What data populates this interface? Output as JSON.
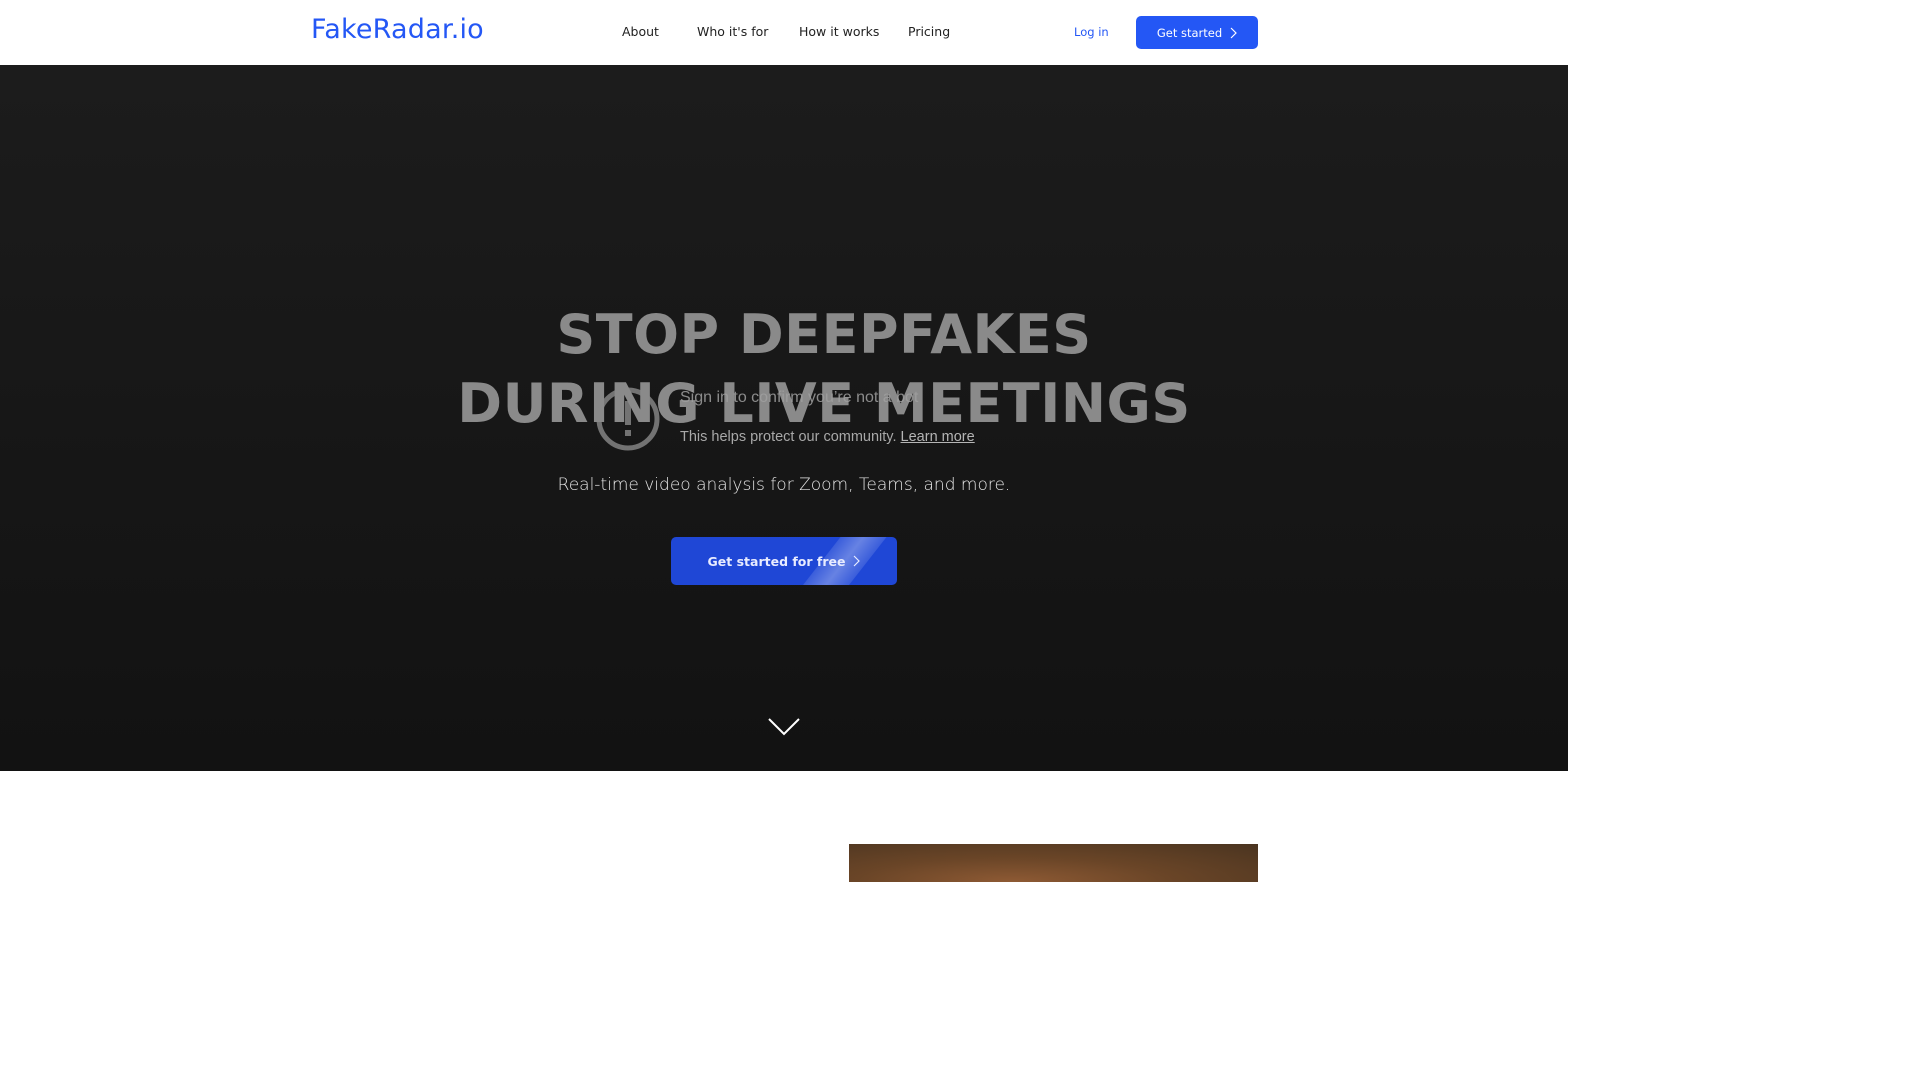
{
  "header": {
    "logo": "FakeRadar.io",
    "nav": [
      {
        "label": "About"
      },
      {
        "label": "Who it's for"
      },
      {
        "label": "How it works"
      },
      {
        "label": "Pricing"
      }
    ],
    "login_label": "Log in",
    "get_started_label": "Get started",
    "accent_color": "#2457f5"
  },
  "hero": {
    "headline_line1": "STOP DEEPFAKES",
    "headline_line2": "DURING LIVE MEETINGS",
    "subtitle": "Real-time video analysis for Zoom, Teams, and more.",
    "cta_label": "Get started for free",
    "bot_check": {
      "title": "Sign in to confirm you’re not a bot",
      "subtitle": "This helps protect our community.",
      "link": "Learn more",
      "icon": "alert-circle-icon"
    },
    "scroll_icon": "chevron-down-icon"
  }
}
